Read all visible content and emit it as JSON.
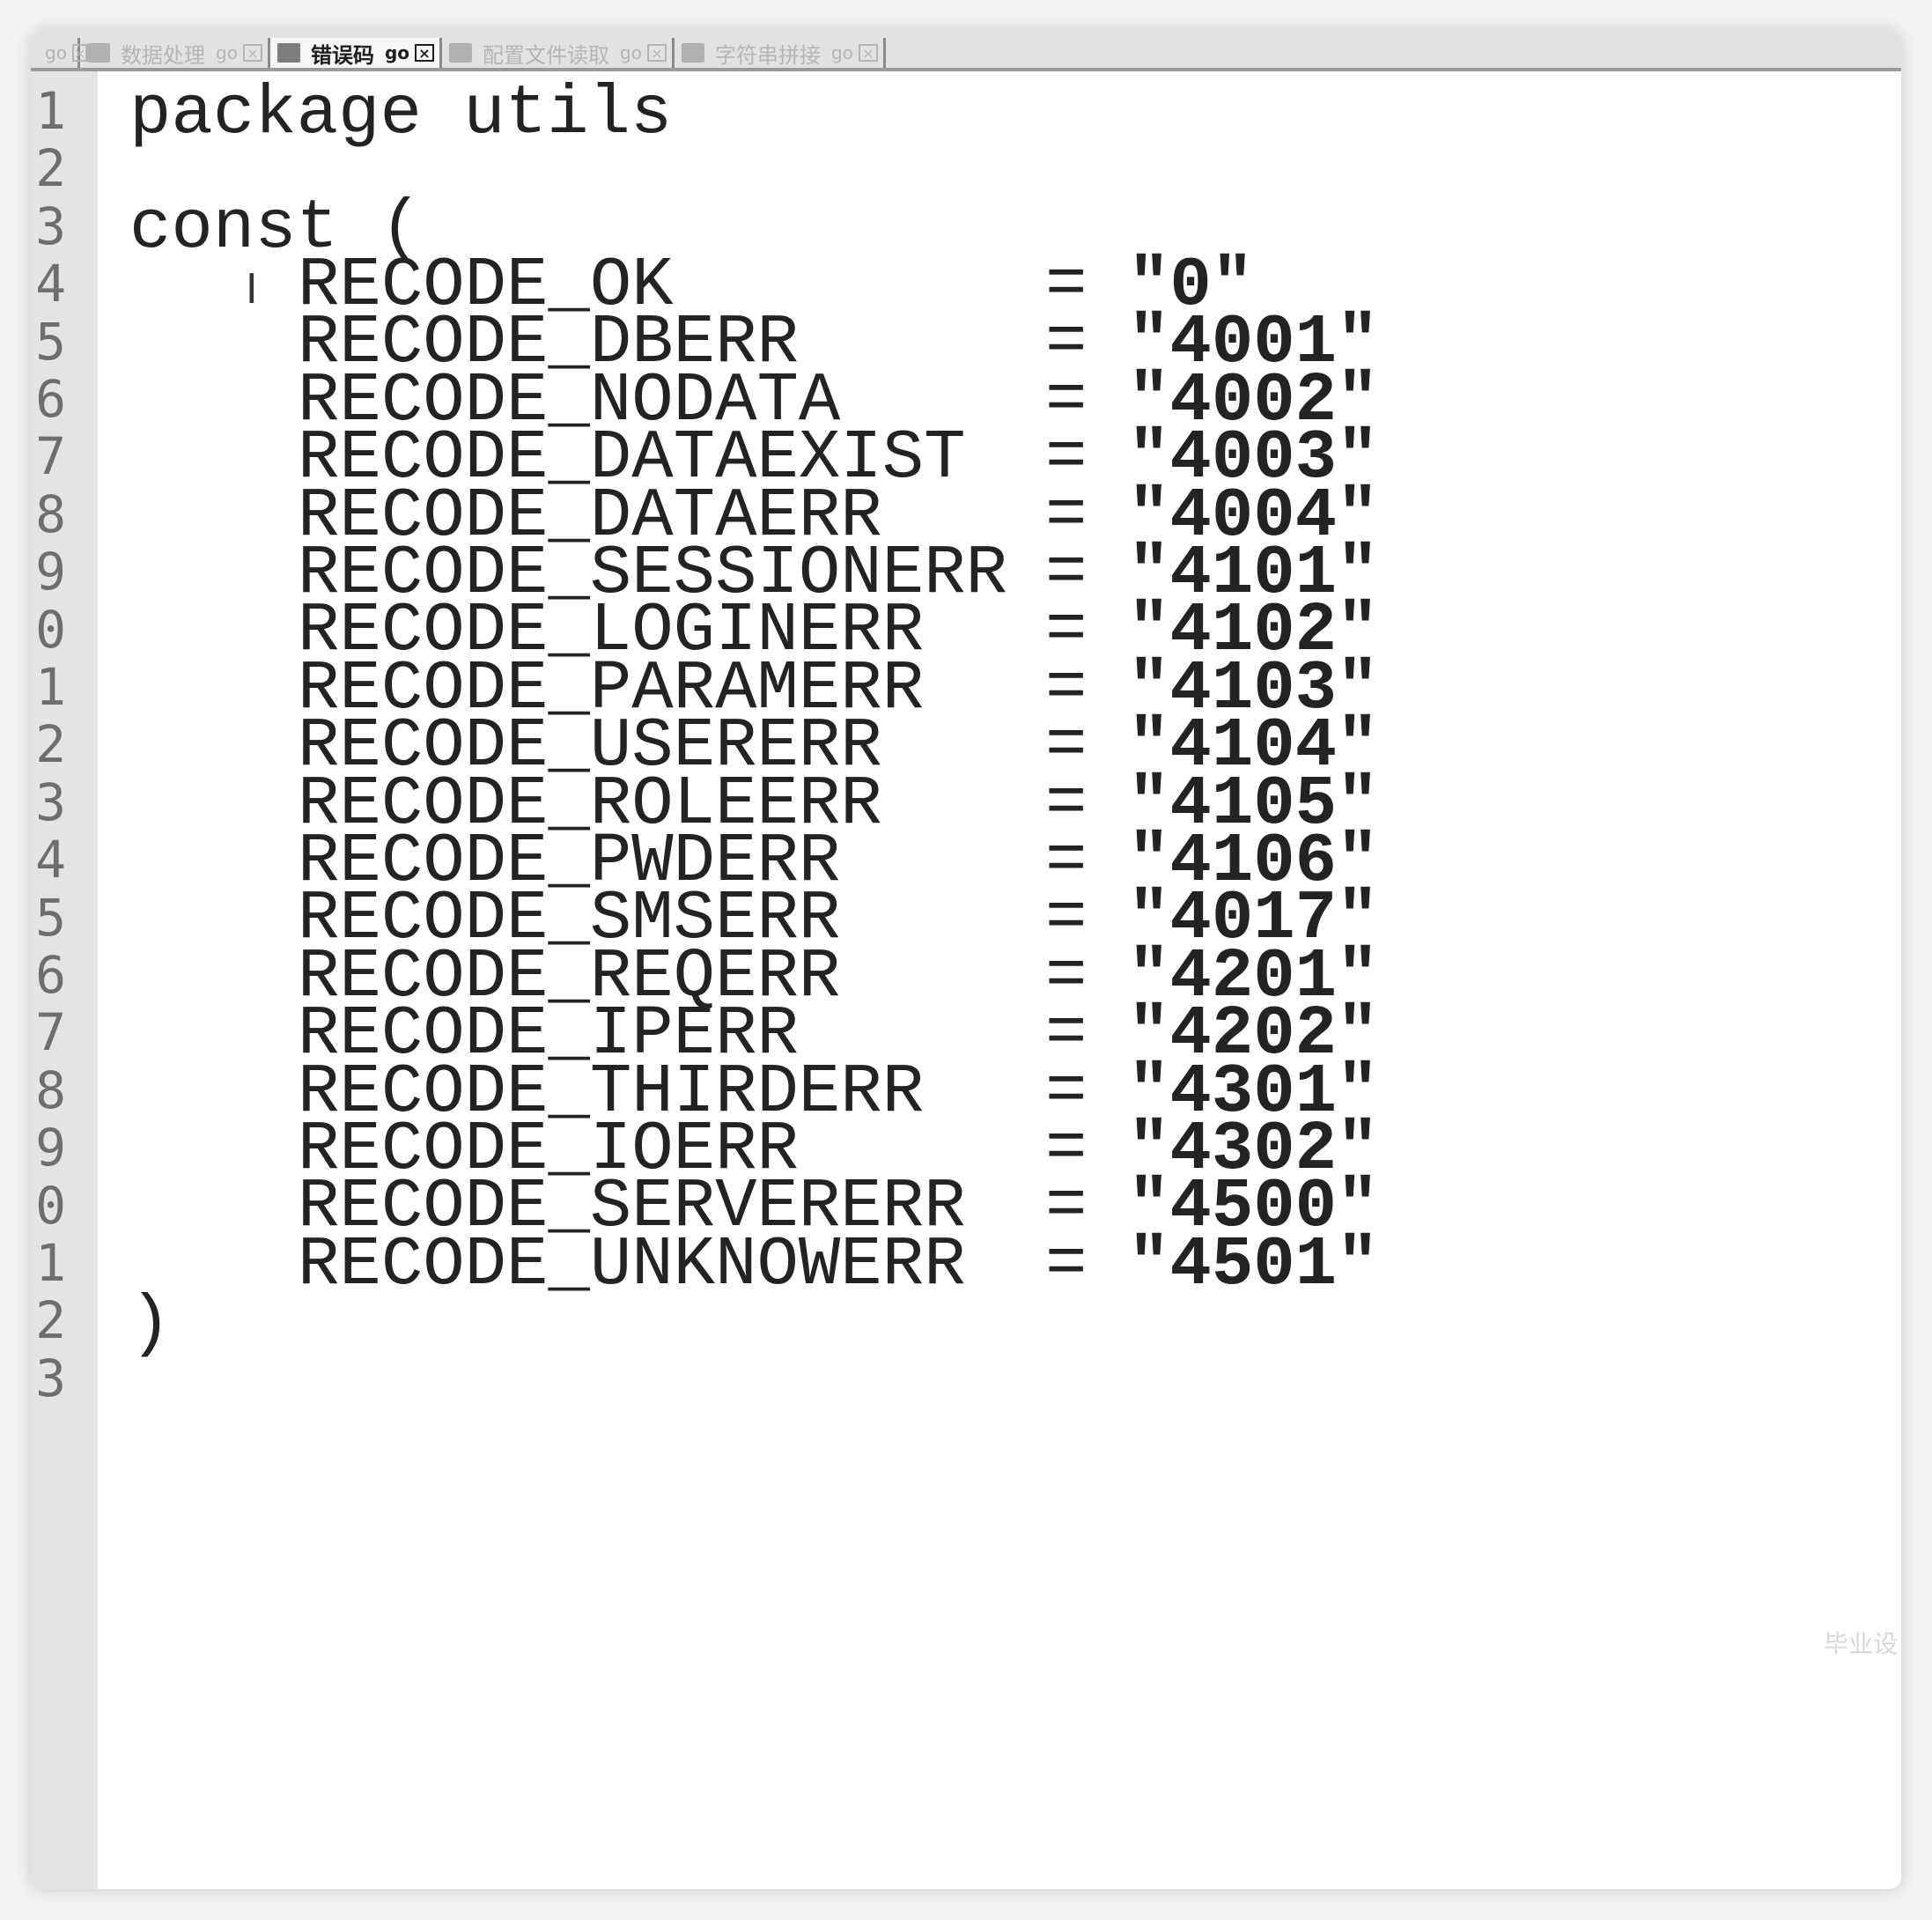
{
  "tabs": [
    {
      "label": "",
      "ext": "go",
      "active": false
    },
    {
      "label": "数据处理",
      "ext": "go",
      "active": false
    },
    {
      "label": "错误码",
      "ext": "go",
      "active": true
    },
    {
      "label": "配置文件读取",
      "ext": "go",
      "active": false
    },
    {
      "label": "字符串拼接",
      "ext": "go",
      "active": false
    }
  ],
  "gutter": [
    "1",
    "2",
    "3",
    "4",
    "5",
    "6",
    "7",
    "8",
    "9",
    "0",
    "1",
    "2",
    "3",
    "4",
    "5",
    "6",
    "7",
    "8",
    "9",
    "0",
    "1",
    "2",
    "3"
  ],
  "code": {
    "package_line": "package utils",
    "const_open": "const (",
    "const_close": ")",
    "constants": [
      {
        "name": "RECODE_OK",
        "value": "\"0\""
      },
      {
        "name": "RECODE_DBERR",
        "value": "\"4001\""
      },
      {
        "name": "RECODE_NODATA",
        "value": "\"4002\""
      },
      {
        "name": "RECODE_DATAEXIST",
        "value": "\"4003\""
      },
      {
        "name": "RECODE_DATAERR",
        "value": "\"4004\""
      },
      {
        "name": "RECODE_SESSIONERR",
        "value": "\"4101\""
      },
      {
        "name": "RECODE_LOGINERR",
        "value": "\"4102\""
      },
      {
        "name": "RECODE_PARAMERR",
        "value": "\"4103\""
      },
      {
        "name": "RECODE_USERERR",
        "value": "\"4104\""
      },
      {
        "name": "RECODE_ROLEERR",
        "value": "\"4105\""
      },
      {
        "name": "RECODE_PWDERR",
        "value": "\"4106\""
      },
      {
        "name": "RECODE_SMSERR",
        "value": "\"4017\""
      },
      {
        "name": "RECODE_REQERR",
        "value": "\"4201\""
      },
      {
        "name": "RECODE_IPERR",
        "value": "\"4202\""
      },
      {
        "name": "RECODE_THIRDERR",
        "value": "\"4301\""
      },
      {
        "name": "RECODE_IOERR",
        "value": "\"4302\""
      },
      {
        "name": "RECODE_SERVERERR",
        "value": "\"4500\""
      },
      {
        "name": "RECODE_UNKNOWERR",
        "value": "\"4501\""
      }
    ],
    "assign_op": "="
  },
  "cursor_glyph": "I",
  "watermark": "毕业设"
}
